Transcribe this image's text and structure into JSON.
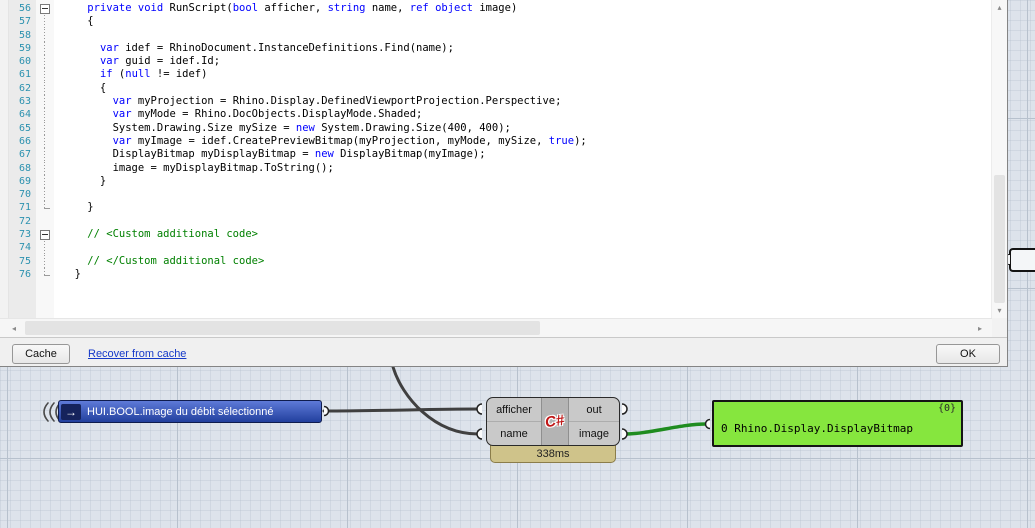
{
  "colors": {
    "keyword": "#0000ff",
    "comment": "#008000",
    "plain_code": "#000000",
    "line_number": "#2b91af",
    "canvas_bg": "#dde3eb",
    "node_blue": "#22409e",
    "panel_green": "#86e63e",
    "wire_dark": "#404040",
    "wire_green": "#1f8c1f",
    "badge_tan": "#cfc38a",
    "logo_red": "#c01818",
    "link_blue": "#1539c9"
  },
  "icons": {
    "hui_arrow": "→",
    "scroll_left": "◂",
    "scroll_right": "▸",
    "scroll_up": "▴",
    "scroll_down": "▾"
  },
  "editor": {
    "code_lines": [
      {
        "n": "56",
        "f": "box",
        "s": [
          [
            "p",
            "    "
          ],
          [
            "k",
            "private"
          ],
          [
            "p",
            " "
          ],
          [
            "k",
            "void"
          ],
          [
            "p",
            " RunScript("
          ],
          [
            "k",
            "bool"
          ],
          [
            "p",
            " afficher, "
          ],
          [
            "k",
            "string"
          ],
          [
            "p",
            " name, "
          ],
          [
            "k",
            "ref"
          ],
          [
            "p",
            " "
          ],
          [
            "k",
            "object"
          ],
          [
            "p",
            " image)"
          ]
        ]
      },
      {
        "n": "57",
        "f": "line",
        "s": [
          [
            "p",
            "    {"
          ]
        ]
      },
      {
        "n": "58",
        "f": "line",
        "s": []
      },
      {
        "n": "59",
        "f": "line",
        "s": [
          [
            "p",
            "      "
          ],
          [
            "k",
            "var"
          ],
          [
            "p",
            " idef = RhinoDocument.InstanceDefinitions.Find(name);"
          ]
        ]
      },
      {
        "n": "60",
        "f": "line",
        "s": [
          [
            "p",
            "      "
          ],
          [
            "k",
            "var"
          ],
          [
            "p",
            " guid = idef.Id;"
          ]
        ]
      },
      {
        "n": "61",
        "f": "line",
        "s": [
          [
            "p",
            "      "
          ],
          [
            "k",
            "if"
          ],
          [
            "p",
            " ("
          ],
          [
            "k",
            "null"
          ],
          [
            "p",
            " != idef)"
          ]
        ]
      },
      {
        "n": "62",
        "f": "line",
        "s": [
          [
            "p",
            "      {"
          ]
        ]
      },
      {
        "n": "63",
        "f": "line",
        "s": [
          [
            "p",
            "        "
          ],
          [
            "k",
            "var"
          ],
          [
            "p",
            " myProjection = Rhino.Display.DefinedViewportProjection.Perspective;"
          ]
        ]
      },
      {
        "n": "64",
        "f": "line",
        "s": [
          [
            "p",
            "        "
          ],
          [
            "k",
            "var"
          ],
          [
            "p",
            " myMode = Rhino.DocObjects.DisplayMode.Shaded;"
          ]
        ]
      },
      {
        "n": "65",
        "f": "line",
        "s": [
          [
            "p",
            "        System.Drawing.Size mySize = "
          ],
          [
            "k",
            "new"
          ],
          [
            "p",
            " System.Drawing.Size(400, 400);"
          ]
        ]
      },
      {
        "n": "66",
        "f": "line",
        "s": [
          [
            "p",
            "        "
          ],
          [
            "k",
            "var"
          ],
          [
            "p",
            " myImage = idef.CreatePreviewBitmap(myProjection, myMode, mySize, "
          ],
          [
            "k",
            "true"
          ],
          [
            "p",
            ");"
          ]
        ]
      },
      {
        "n": "67",
        "f": "line",
        "s": [
          [
            "p",
            "        DisplayBitmap myDisplayBitmap = "
          ],
          [
            "k",
            "new"
          ],
          [
            "p",
            " DisplayBitmap(myImage);"
          ]
        ]
      },
      {
        "n": "68",
        "f": "line",
        "s": [
          [
            "p",
            "        image = myDisplayBitmap.ToString();"
          ]
        ]
      },
      {
        "n": "69",
        "f": "line",
        "s": [
          [
            "p",
            "      }"
          ]
        ]
      },
      {
        "n": "70",
        "f": "line",
        "s": []
      },
      {
        "n": "71",
        "f": "end",
        "s": [
          [
            "p",
            "    }"
          ]
        ]
      },
      {
        "n": "72",
        "f": "",
        "s": []
      },
      {
        "n": "73",
        "f": "box",
        "s": [
          [
            "c",
            "    // <Custom additional code>"
          ]
        ]
      },
      {
        "n": "74",
        "f": "line",
        "s": []
      },
      {
        "n": "75",
        "f": "line",
        "s": [
          [
            "c",
            "    // </Custom additional code>"
          ]
        ]
      },
      {
        "n": "76",
        "f": "end",
        "s": [
          [
            "p",
            "  }"
          ]
        ]
      }
    ]
  },
  "toolbar": {
    "cache_label": "Cache",
    "recover_link": "Recover from cache",
    "ok_label": "OK"
  },
  "canvas": {
    "hui_node": {
      "label": "HUI.BOOL.image du débit sélectionné"
    },
    "cs": {
      "inputs": [
        "afficher",
        "name"
      ],
      "outputs": [
        "out",
        "image"
      ],
      "logo": "C#",
      "time": "338ms"
    },
    "panel": {
      "text": "0 Rhino.Display.DisplayBitmap",
      "count": "{0}"
    }
  }
}
